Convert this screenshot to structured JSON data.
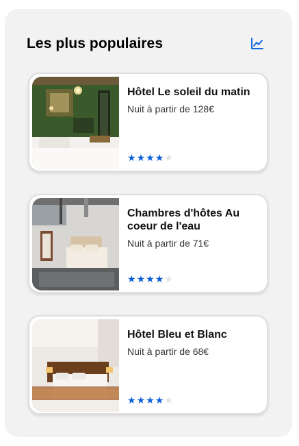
{
  "section": {
    "title": "Les plus populaires",
    "action_icon": "trending-up-icon",
    "accent": "#1468e0"
  },
  "hotels": [
    {
      "name": "Hôtel Le soleil du matin",
      "price_text": "Nuit à partir de 128€",
      "rating": 4,
      "max_rating": 5
    },
    {
      "name": "Chambres d'hôtes Au coeur de l'eau",
      "price_text": "Nuit à partir de 71€",
      "rating": 4,
      "max_rating": 5
    },
    {
      "name": "Hôtel Bleu et Blanc",
      "price_text": "Nuit à partir de 68€",
      "rating": 4,
      "max_rating": 5
    }
  ]
}
